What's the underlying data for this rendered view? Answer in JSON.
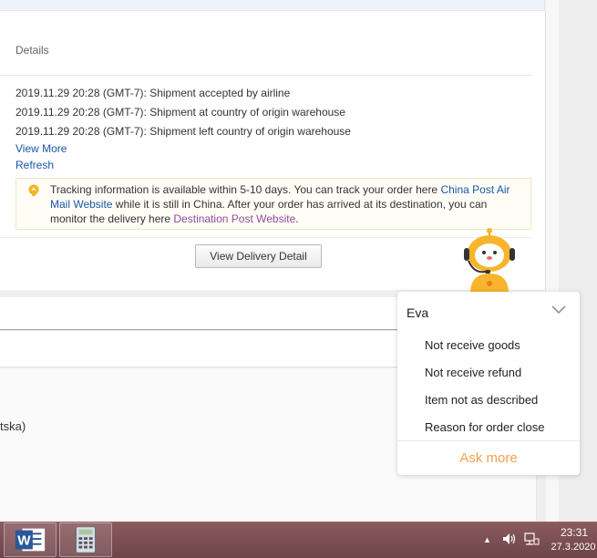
{
  "tracking": {
    "details_label": "Details",
    "events": [
      "2019.11.29 20:28 (GMT-7): Shipment accepted by airline",
      "2019.11.29 20:28 (GMT-7): Shipment at country of origin warehouse",
      "2019.11.29 20:28 (GMT-7): Shipment left country of origin warehouse"
    ],
    "view_more": "View More",
    "refresh": "Refresh",
    "notice": {
      "text1": "Tracking information is available within 5-10 days. You can track your order here ",
      "link1": "China Post Air Mail Website",
      "text2": " while it is still in China. After your order has arrived at its destination, you can monitor the delivery here ",
      "link2": "Destination Post Website",
      "text3": ".",
      "icon": "lightbulb-icon"
    },
    "view_delivery_button": "View Delivery Detail"
  },
  "partial_text": "tska)",
  "chat": {
    "agent_name": "Eva",
    "options": [
      "Not receive goods",
      "Not receive refund",
      "Item not as described",
      "Reason for order close"
    ],
    "ask_more": "Ask more",
    "accent": "#f0a24e"
  },
  "taskbar": {
    "apps": [
      "word-icon",
      "calculator-icon"
    ],
    "time": "23:31",
    "date": "27.3.2020"
  },
  "colors": {
    "link": "#1a56a8",
    "visited_link": "#8f4a9e",
    "taskbar": "#7a4e52"
  }
}
